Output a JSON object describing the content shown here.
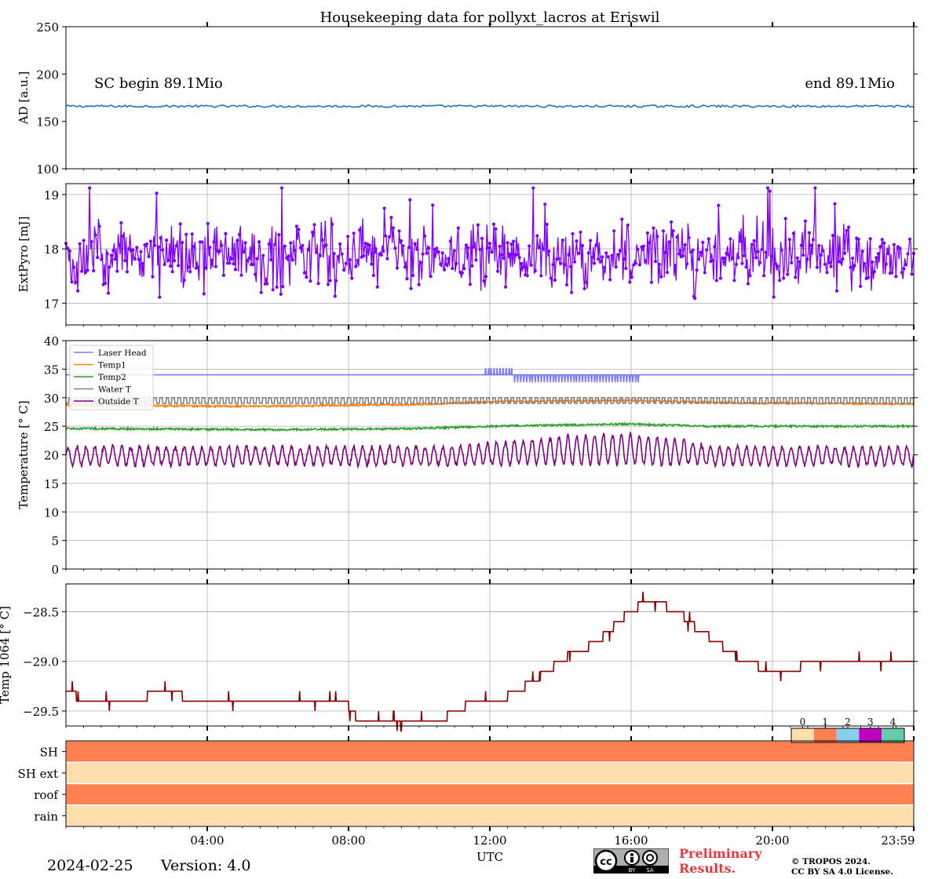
{
  "title": "Housekeeping data for pollyxt_lacros at Eriswil",
  "footer": {
    "date": "2024-02-25",
    "version": "Version: 4.0",
    "preliminary_line1": "Preliminary",
    "preliminary_line2": "Results.",
    "copyright_line1": "© TROPOS 2024.",
    "copyright_line2": "CC BY SA 4.0 License.",
    "license_badge": "cc-by-sa-icon"
  },
  "chart_data": [
    {
      "type": "line",
      "id": "ad",
      "ylabel": "AD [a.u.]",
      "ylim": [
        100,
        250
      ],
      "yticks": [
        100,
        150,
        200,
        250
      ],
      "grid": false,
      "annotations": {
        "left": "SC begin 89.1Mio",
        "right": "end 89.1Mio"
      },
      "series": [
        {
          "color": "#1f77b4",
          "x_hours": [
            0,
            24
          ],
          "mean": 166,
          "jitter": 1.2,
          "samples": 430
        }
      ]
    },
    {
      "type": "line",
      "id": "extpyro",
      "ylabel": "ExtPyro [mJ]",
      "ylim": [
        16.6,
        19.2
      ],
      "yticks": [
        17,
        18,
        19
      ],
      "grid": true,
      "series": [
        {
          "color": "#7f00ff",
          "x_hours": [
            0,
            24
          ],
          "mean": 17.85,
          "spread": 0.42,
          "samples": 860,
          "markers": true
        }
      ]
    },
    {
      "type": "line",
      "id": "temperature",
      "ylabel": "Temperature [$^\\circ C$]",
      "ylim": [
        0,
        40
      ],
      "yticks": [
        0,
        5,
        10,
        15,
        20,
        25,
        30,
        35,
        40
      ],
      "grid": true,
      "legend": "top-left",
      "series": [
        {
          "name": "Laser Head",
          "color": "#7b7bff",
          "base": 34,
          "dips": true
        },
        {
          "name": "Temp1",
          "color": "#ff7f0e",
          "profile": [
            [
              0,
              28.7
            ],
            [
              5,
              28.5
            ],
            [
              10,
              28.8
            ],
            [
              12,
              29.3
            ],
            [
              16,
              29.5
            ],
            [
              19,
              29.1
            ],
            [
              24,
              28.9
            ]
          ]
        },
        {
          "name": "Temp2",
          "color": "#2ca02c",
          "profile": [
            [
              0,
              24.6
            ],
            [
              6,
              24.4
            ],
            [
              10,
              24.6
            ],
            [
              12,
              25.0
            ],
            [
              16,
              25.4
            ],
            [
              18,
              25.0
            ],
            [
              24,
              25.0
            ]
          ]
        },
        {
          "name": "Water T",
          "color": "#808080",
          "square_wave": [
            29.0,
            30.0
          ],
          "cycles": 140
        },
        {
          "name": "Outside T",
          "color": "#800080",
          "base": 19.8,
          "amplitude": 1.6,
          "cycles": 95,
          "boost": [
            [
              11,
              0.0
            ],
            [
              14,
              1.6
            ],
            [
              16,
              2.0
            ],
            [
              18,
              0.6
            ]
          ]
        }
      ]
    },
    {
      "type": "line",
      "id": "temp1064",
      "ylabel": "Temp 1064 [$^\\circ C$]",
      "ylim": [
        -29.65,
        -28.22
      ],
      "yticks": [
        -29.5,
        -29.0,
        -28.5
      ],
      "ytick_labels": [
        "−29.5",
        "−29.0",
        "−28.5"
      ],
      "grid": true,
      "series": [
        {
          "color": "#8b0000",
          "steps": [
            [
              0,
              -29.3
            ],
            [
              0.3,
              -29.4
            ],
            [
              2.3,
              -29.3
            ],
            [
              3.3,
              -29.4
            ],
            [
              5.2,
              -29.4
            ],
            [
              8.0,
              -29.5
            ],
            [
              8.2,
              -29.6
            ],
            [
              10.8,
              -29.5
            ],
            [
              11.3,
              -29.4
            ],
            [
              12.5,
              -29.3
            ],
            [
              13.0,
              -29.2
            ],
            [
              13.4,
              -29.1
            ],
            [
              13.8,
              -29.0
            ],
            [
              14.2,
              -28.9
            ],
            [
              14.8,
              -28.8
            ],
            [
              15.2,
              -28.7
            ],
            [
              15.5,
              -28.6
            ],
            [
              15.8,
              -28.5
            ],
            [
              16.2,
              -28.4
            ],
            [
              16.6,
              -28.4
            ],
            [
              17.0,
              -28.5
            ],
            [
              17.5,
              -28.6
            ],
            [
              17.8,
              -28.7
            ],
            [
              18.2,
              -28.8
            ],
            [
              18.6,
              -28.9
            ],
            [
              19.0,
              -29.0
            ],
            [
              19.6,
              -29.1
            ],
            [
              20.8,
              -29.0
            ],
            [
              24,
              -29.0
            ]
          ]
        }
      ]
    },
    {
      "type": "heatmap",
      "id": "status",
      "rows": [
        "SH",
        "SH ext",
        "roof",
        "rain"
      ],
      "row_values": [
        1,
        0,
        1,
        0
      ],
      "colorbar": {
        "ticks": [
          "0",
          "1",
          "2",
          "3",
          "4"
        ],
        "colors": [
          "#ffdead",
          "#ff7f50",
          "#87ceeb",
          "#c000c0",
          "#66cdaa"
        ]
      }
    }
  ],
  "x_axis": {
    "xlabel": "UTC",
    "xlim_hours": [
      0,
      24
    ],
    "tick_hours": [
      4,
      8,
      12,
      16,
      20,
      24
    ],
    "tick_labels": [
      "04:00",
      "08:00",
      "12:00",
      "16:00",
      "20:00",
      "23:59"
    ]
  }
}
